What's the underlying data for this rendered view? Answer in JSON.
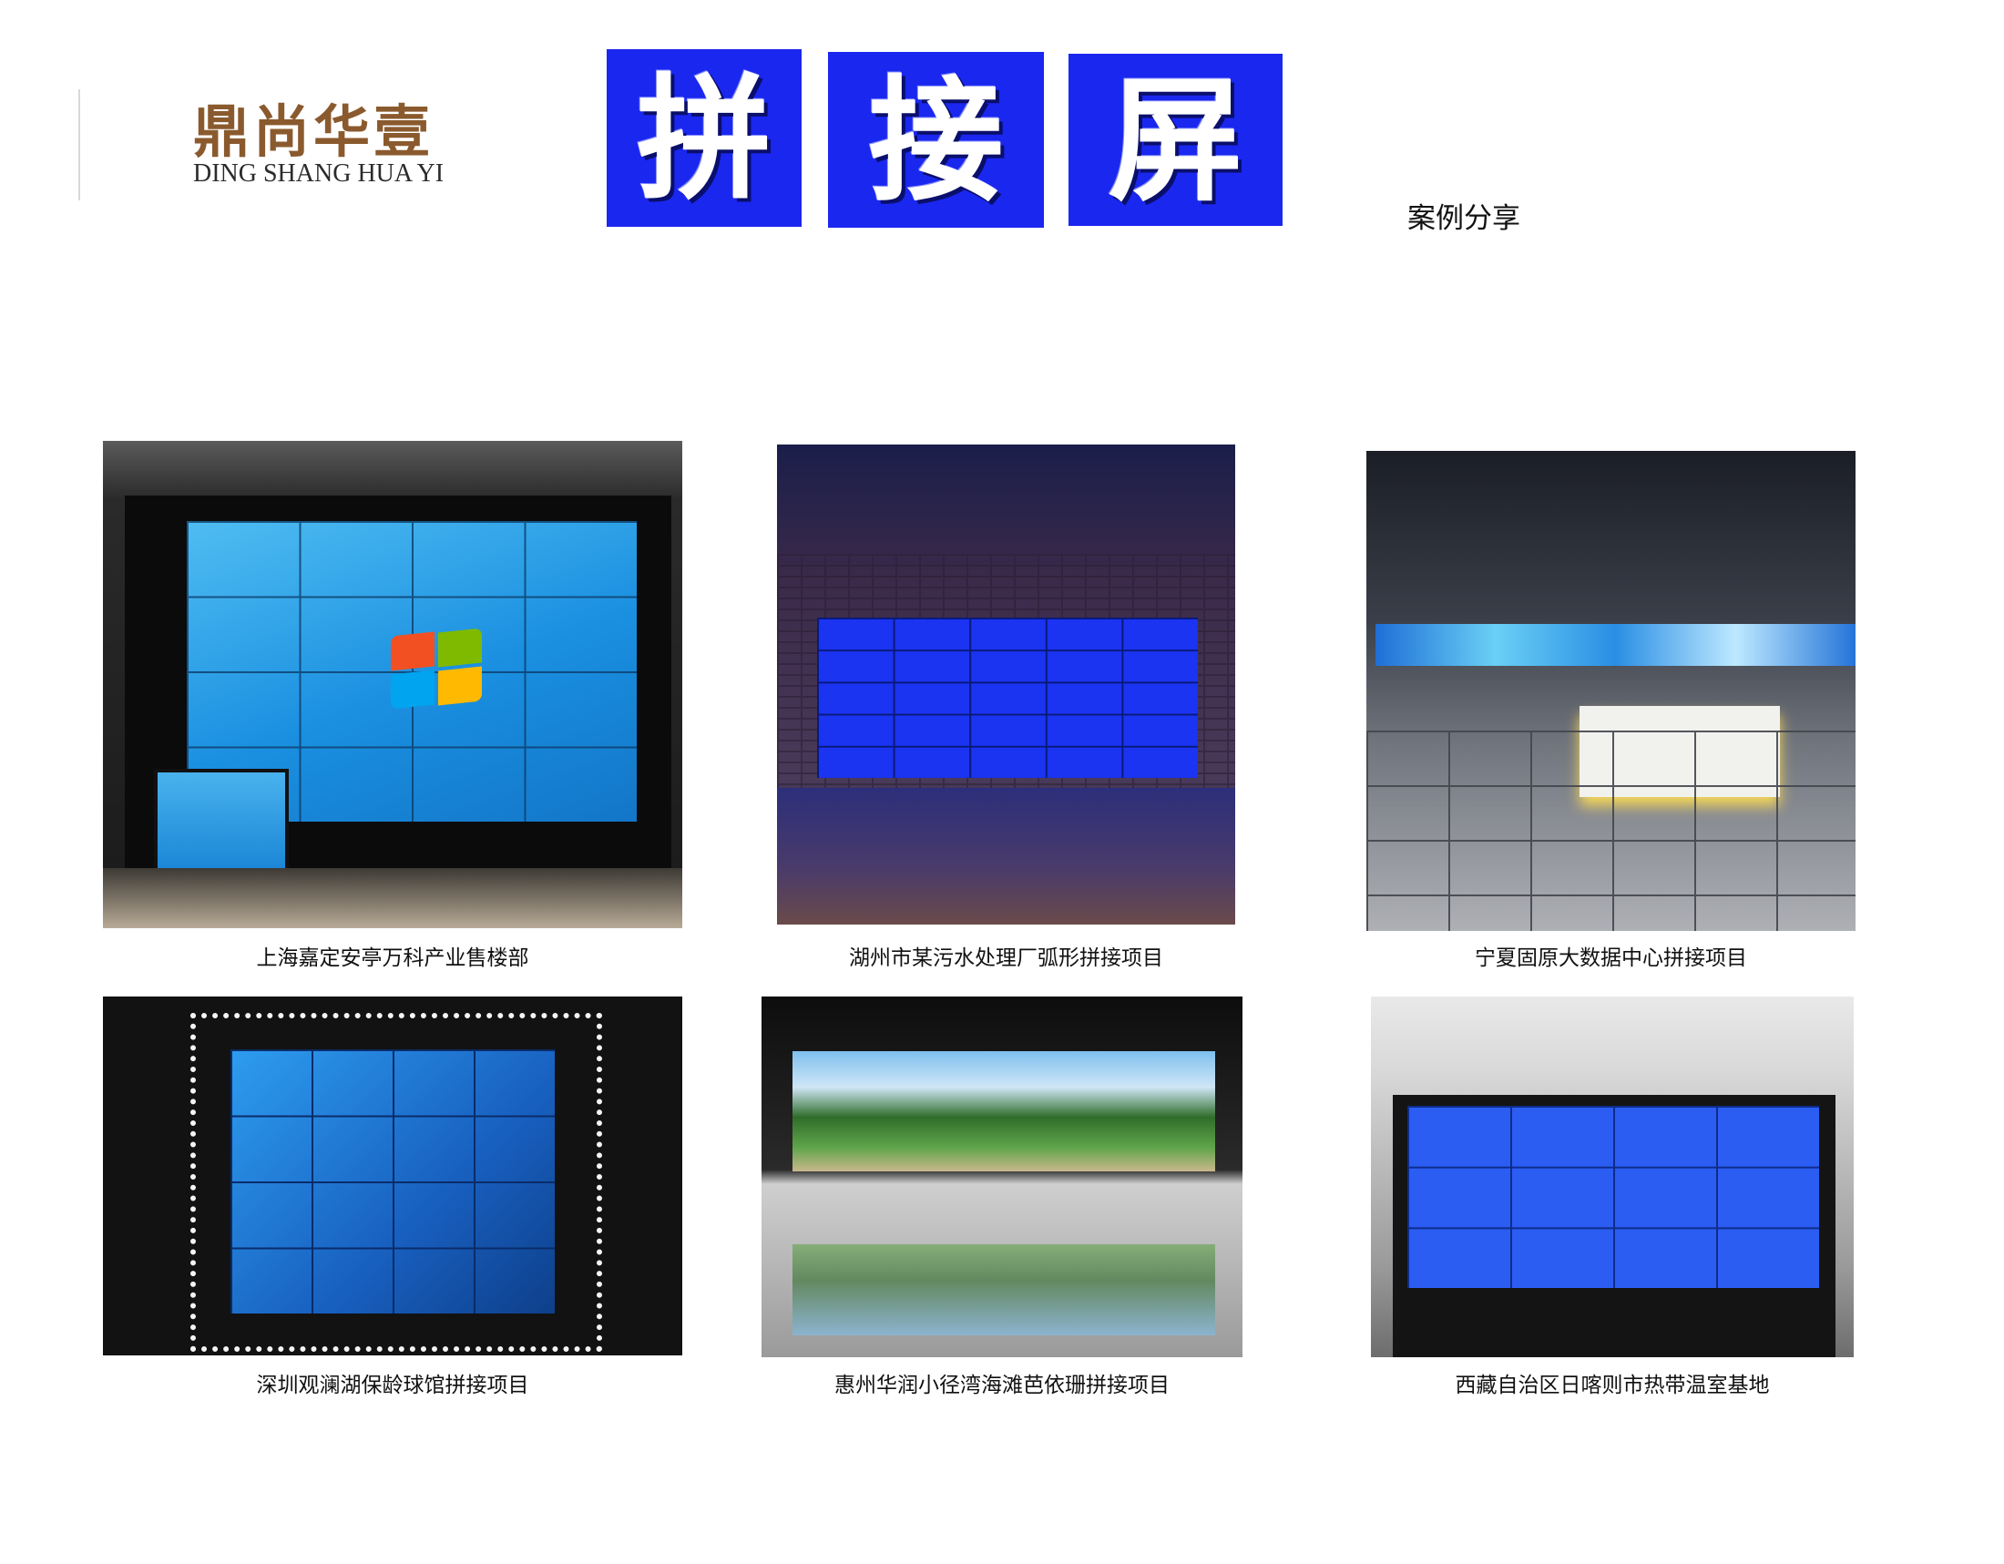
{
  "logo": {
    "chinese": "鼎尚华壹",
    "english": "DING SHANG HUA YI"
  },
  "title": {
    "chars": [
      "拼",
      "接",
      "屏"
    ],
    "subtitle": "案例分享"
  },
  "cases": [
    {
      "caption": "上海嘉定安亭万科产业售楼部"
    },
    {
      "caption": "湖州市某污水处理厂弧形拼接项目"
    },
    {
      "caption": "宁夏固原大数据中心拼接项目"
    },
    {
      "caption": "深圳观澜湖保龄球馆拼接项目"
    },
    {
      "caption": "惠州华润小径湾海滩芭依珊拼接项目"
    },
    {
      "caption": "西藏自治区日喀则市热带温室基地"
    }
  ]
}
